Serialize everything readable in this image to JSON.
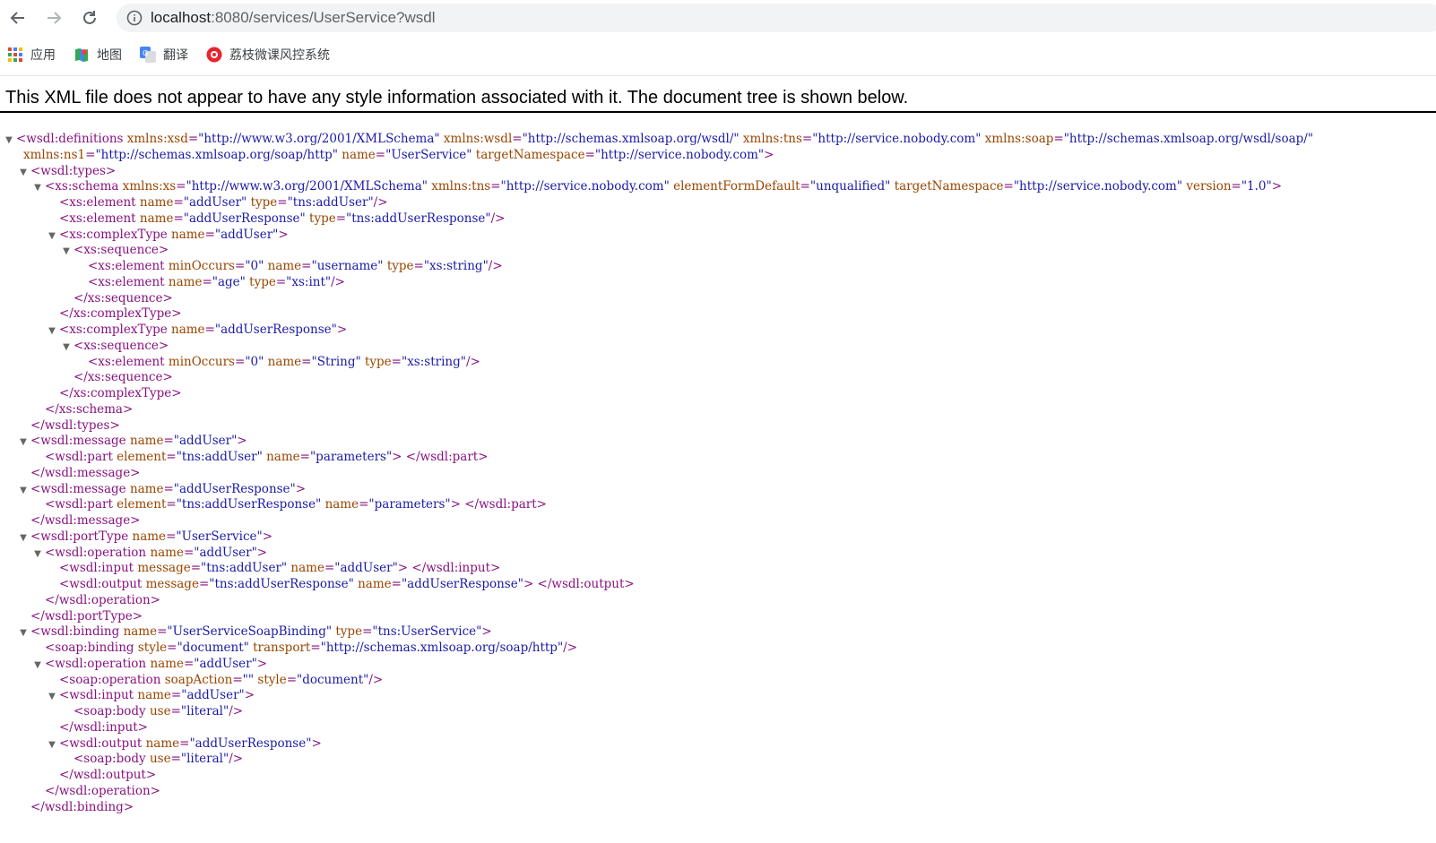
{
  "browser": {
    "url_host": "localhost",
    "url_rest": ":8080/services/UserService?wsdl",
    "bookmarks": [
      {
        "label": "应用",
        "icon": "apps-grid-icon"
      },
      {
        "label": "地图",
        "icon": "maps-icon"
      },
      {
        "label": "翻译",
        "icon": "translate-icon"
      },
      {
        "label": "荔枝微课风控系统",
        "icon": "lizhi-icon"
      }
    ]
  },
  "xml_notice": "This XML file does not appear to have any style information associated with it. The document tree is shown below.",
  "colors": {
    "tag": "#881280",
    "attr": "#994500",
    "value": "#1a1aa6"
  },
  "xml_lines": [
    {
      "d": 0,
      "t": true,
      "p": [
        [
          "tag",
          "<wsdl:definitions"
        ],
        [
          "sp",
          " "
        ],
        [
          "attr",
          "xmlns:xsd"
        ],
        [
          "tag",
          "="
        ],
        [
          "val",
          "\"http://www.w3.org/2001/XMLSchema\""
        ],
        [
          "sp",
          " "
        ],
        [
          "attr",
          "xmlns:wsdl"
        ],
        [
          "tag",
          "="
        ],
        [
          "val",
          "\"http://schemas.xmlsoap.org/wsdl/\""
        ],
        [
          "sp",
          " "
        ],
        [
          "attr",
          "xmlns:tns"
        ],
        [
          "tag",
          "="
        ],
        [
          "val",
          "\"http://service.nobody.com\""
        ],
        [
          "sp",
          " "
        ],
        [
          "attr",
          "xmlns:soap"
        ],
        [
          "tag",
          "="
        ],
        [
          "val",
          "\"http://schemas.xmlsoap.org/wsdl/soap/\""
        ]
      ]
    },
    {
      "d": 0.5,
      "t": false,
      "p": [
        [
          "attr",
          "xmlns:ns1"
        ],
        [
          "tag",
          "="
        ],
        [
          "val",
          "\"http://schemas.xmlsoap.org/soap/http\""
        ],
        [
          "sp",
          " "
        ],
        [
          "attr",
          "name"
        ],
        [
          "tag",
          "="
        ],
        [
          "val",
          "\"UserService\""
        ],
        [
          "sp",
          " "
        ],
        [
          "attr",
          "targetNamespace"
        ],
        [
          "tag",
          "="
        ],
        [
          "val",
          "\"http://service.nobody.com\""
        ],
        [
          "tag",
          ">"
        ]
      ]
    },
    {
      "d": 1,
      "t": true,
      "p": [
        [
          "tag",
          "<wsdl:types>"
        ]
      ]
    },
    {
      "d": 2,
      "t": true,
      "p": [
        [
          "tag",
          "<xs:schema"
        ],
        [
          "sp",
          " "
        ],
        [
          "attr",
          "xmlns:xs"
        ],
        [
          "tag",
          "="
        ],
        [
          "val",
          "\"http://www.w3.org/2001/XMLSchema\""
        ],
        [
          "sp",
          " "
        ],
        [
          "attr",
          "xmlns:tns"
        ],
        [
          "tag",
          "="
        ],
        [
          "val",
          "\"http://service.nobody.com\""
        ],
        [
          "sp",
          " "
        ],
        [
          "attr",
          "elementFormDefault"
        ],
        [
          "tag",
          "="
        ],
        [
          "val",
          "\"unqualified\""
        ],
        [
          "sp",
          " "
        ],
        [
          "attr",
          "targetNamespace"
        ],
        [
          "tag",
          "="
        ],
        [
          "val",
          "\"http://service.nobody.com\""
        ],
        [
          "sp",
          " "
        ],
        [
          "attr",
          "version"
        ],
        [
          "tag",
          "="
        ],
        [
          "val",
          "\"1.0\""
        ],
        [
          "tag",
          ">"
        ]
      ]
    },
    {
      "d": 3,
      "t": false,
      "p": [
        [
          "tag",
          "<xs:element"
        ],
        [
          "sp",
          " "
        ],
        [
          "attr",
          "name"
        ],
        [
          "tag",
          "="
        ],
        [
          "val",
          "\"addUser\""
        ],
        [
          "sp",
          " "
        ],
        [
          "attr",
          "type"
        ],
        [
          "tag",
          "="
        ],
        [
          "val",
          "\"tns:addUser\""
        ],
        [
          "tag",
          "/>"
        ]
      ]
    },
    {
      "d": 3,
      "t": false,
      "p": [
        [
          "tag",
          "<xs:element"
        ],
        [
          "sp",
          " "
        ],
        [
          "attr",
          "name"
        ],
        [
          "tag",
          "="
        ],
        [
          "val",
          "\"addUserResponse\""
        ],
        [
          "sp",
          " "
        ],
        [
          "attr",
          "type"
        ],
        [
          "tag",
          "="
        ],
        [
          "val",
          "\"tns:addUserResponse\""
        ],
        [
          "tag",
          "/>"
        ]
      ]
    },
    {
      "d": 3,
      "t": true,
      "p": [
        [
          "tag",
          "<xs:complexType"
        ],
        [
          "sp",
          " "
        ],
        [
          "attr",
          "name"
        ],
        [
          "tag",
          "="
        ],
        [
          "val",
          "\"addUser\""
        ],
        [
          "tag",
          ">"
        ]
      ]
    },
    {
      "d": 4,
      "t": true,
      "p": [
        [
          "tag",
          "<xs:sequence>"
        ]
      ]
    },
    {
      "d": 5,
      "t": false,
      "p": [
        [
          "tag",
          "<xs:element"
        ],
        [
          "sp",
          " "
        ],
        [
          "attr",
          "minOccurs"
        ],
        [
          "tag",
          "="
        ],
        [
          "val",
          "\"0\""
        ],
        [
          "sp",
          " "
        ],
        [
          "attr",
          "name"
        ],
        [
          "tag",
          "="
        ],
        [
          "val",
          "\"username\""
        ],
        [
          "sp",
          " "
        ],
        [
          "attr",
          "type"
        ],
        [
          "tag",
          "="
        ],
        [
          "val",
          "\"xs:string\""
        ],
        [
          "tag",
          "/>"
        ]
      ]
    },
    {
      "d": 5,
      "t": false,
      "p": [
        [
          "tag",
          "<xs:element"
        ],
        [
          "sp",
          " "
        ],
        [
          "attr",
          "name"
        ],
        [
          "tag",
          "="
        ],
        [
          "val",
          "\"age\""
        ],
        [
          "sp",
          " "
        ],
        [
          "attr",
          "type"
        ],
        [
          "tag",
          "="
        ],
        [
          "val",
          "\"xs:int\""
        ],
        [
          "tag",
          "/>"
        ]
      ]
    },
    {
      "d": 4,
      "t": false,
      "p": [
        [
          "tag",
          "</xs:sequence>"
        ]
      ]
    },
    {
      "d": 3,
      "t": false,
      "p": [
        [
          "tag",
          "</xs:complexType>"
        ]
      ]
    },
    {
      "d": 3,
      "t": true,
      "p": [
        [
          "tag",
          "<xs:complexType"
        ],
        [
          "sp",
          " "
        ],
        [
          "attr",
          "name"
        ],
        [
          "tag",
          "="
        ],
        [
          "val",
          "\"addUserResponse\""
        ],
        [
          "tag",
          ">"
        ]
      ]
    },
    {
      "d": 4,
      "t": true,
      "p": [
        [
          "tag",
          "<xs:sequence>"
        ]
      ]
    },
    {
      "d": 5,
      "t": false,
      "p": [
        [
          "tag",
          "<xs:element"
        ],
        [
          "sp",
          " "
        ],
        [
          "attr",
          "minOccurs"
        ],
        [
          "tag",
          "="
        ],
        [
          "val",
          "\"0\""
        ],
        [
          "sp",
          " "
        ],
        [
          "attr",
          "name"
        ],
        [
          "tag",
          "="
        ],
        [
          "val",
          "\"String\""
        ],
        [
          "sp",
          " "
        ],
        [
          "attr",
          "type"
        ],
        [
          "tag",
          "="
        ],
        [
          "val",
          "\"xs:string\""
        ],
        [
          "tag",
          "/>"
        ]
      ]
    },
    {
      "d": 4,
      "t": false,
      "p": [
        [
          "tag",
          "</xs:sequence>"
        ]
      ]
    },
    {
      "d": 3,
      "t": false,
      "p": [
        [
          "tag",
          "</xs:complexType>"
        ]
      ]
    },
    {
      "d": 2,
      "t": false,
      "p": [
        [
          "tag",
          "</xs:schema>"
        ]
      ]
    },
    {
      "d": 1,
      "t": false,
      "p": [
        [
          "tag",
          "</wsdl:types>"
        ]
      ]
    },
    {
      "d": 1,
      "t": true,
      "p": [
        [
          "tag",
          "<wsdl:message"
        ],
        [
          "sp",
          " "
        ],
        [
          "attr",
          "name"
        ],
        [
          "tag",
          "="
        ],
        [
          "val",
          "\"addUser\""
        ],
        [
          "tag",
          ">"
        ]
      ]
    },
    {
      "d": 2,
      "t": false,
      "p": [
        [
          "tag",
          "<wsdl:part"
        ],
        [
          "sp",
          " "
        ],
        [
          "attr",
          "element"
        ],
        [
          "tag",
          "="
        ],
        [
          "val",
          "\"tns:addUser\""
        ],
        [
          "sp",
          " "
        ],
        [
          "attr",
          "name"
        ],
        [
          "tag",
          "="
        ],
        [
          "val",
          "\"parameters\""
        ],
        [
          "tag",
          ">"
        ],
        [
          "sp",
          " "
        ],
        [
          "tag",
          "</wsdl:part>"
        ]
      ]
    },
    {
      "d": 1,
      "t": false,
      "p": [
        [
          "tag",
          "</wsdl:message>"
        ]
      ]
    },
    {
      "d": 1,
      "t": true,
      "p": [
        [
          "tag",
          "<wsdl:message"
        ],
        [
          "sp",
          " "
        ],
        [
          "attr",
          "name"
        ],
        [
          "tag",
          "="
        ],
        [
          "val",
          "\"addUserResponse\""
        ],
        [
          "tag",
          ">"
        ]
      ]
    },
    {
      "d": 2,
      "t": false,
      "p": [
        [
          "tag",
          "<wsdl:part"
        ],
        [
          "sp",
          " "
        ],
        [
          "attr",
          "element"
        ],
        [
          "tag",
          "="
        ],
        [
          "val",
          "\"tns:addUserResponse\""
        ],
        [
          "sp",
          " "
        ],
        [
          "attr",
          "name"
        ],
        [
          "tag",
          "="
        ],
        [
          "val",
          "\"parameters\""
        ],
        [
          "tag",
          ">"
        ],
        [
          "sp",
          " "
        ],
        [
          "tag",
          "</wsdl:part>"
        ]
      ]
    },
    {
      "d": 1,
      "t": false,
      "p": [
        [
          "tag",
          "</wsdl:message>"
        ]
      ]
    },
    {
      "d": 1,
      "t": true,
      "p": [
        [
          "tag",
          "<wsdl:portType"
        ],
        [
          "sp",
          " "
        ],
        [
          "attr",
          "name"
        ],
        [
          "tag",
          "="
        ],
        [
          "val",
          "\"UserService\""
        ],
        [
          "tag",
          ">"
        ]
      ]
    },
    {
      "d": 2,
      "t": true,
      "p": [
        [
          "tag",
          "<wsdl:operation"
        ],
        [
          "sp",
          " "
        ],
        [
          "attr",
          "name"
        ],
        [
          "tag",
          "="
        ],
        [
          "val",
          "\"addUser\""
        ],
        [
          "tag",
          ">"
        ]
      ]
    },
    {
      "d": 3,
      "t": false,
      "p": [
        [
          "tag",
          "<wsdl:input"
        ],
        [
          "sp",
          " "
        ],
        [
          "attr",
          "message"
        ],
        [
          "tag",
          "="
        ],
        [
          "val",
          "\"tns:addUser\""
        ],
        [
          "sp",
          " "
        ],
        [
          "attr",
          "name"
        ],
        [
          "tag",
          "="
        ],
        [
          "val",
          "\"addUser\""
        ],
        [
          "tag",
          ">"
        ],
        [
          "sp",
          " "
        ],
        [
          "tag",
          "</wsdl:input>"
        ]
      ]
    },
    {
      "d": 3,
      "t": false,
      "p": [
        [
          "tag",
          "<wsdl:output"
        ],
        [
          "sp",
          " "
        ],
        [
          "attr",
          "message"
        ],
        [
          "tag",
          "="
        ],
        [
          "val",
          "\"tns:addUserResponse\""
        ],
        [
          "sp",
          " "
        ],
        [
          "attr",
          "name"
        ],
        [
          "tag",
          "="
        ],
        [
          "val",
          "\"addUserResponse\""
        ],
        [
          "tag",
          ">"
        ],
        [
          "sp",
          " "
        ],
        [
          "tag",
          "</wsdl:output>"
        ]
      ]
    },
    {
      "d": 2,
      "t": false,
      "p": [
        [
          "tag",
          "</wsdl:operation>"
        ]
      ]
    },
    {
      "d": 1,
      "t": false,
      "p": [
        [
          "tag",
          "</wsdl:portType>"
        ]
      ]
    },
    {
      "d": 1,
      "t": true,
      "p": [
        [
          "tag",
          "<wsdl:binding"
        ],
        [
          "sp",
          " "
        ],
        [
          "attr",
          "name"
        ],
        [
          "tag",
          "="
        ],
        [
          "val",
          "\"UserServiceSoapBinding\""
        ],
        [
          "sp",
          " "
        ],
        [
          "attr",
          "type"
        ],
        [
          "tag",
          "="
        ],
        [
          "val",
          "\"tns:UserService\""
        ],
        [
          "tag",
          ">"
        ]
      ]
    },
    {
      "d": 2,
      "t": false,
      "p": [
        [
          "tag",
          "<soap:binding"
        ],
        [
          "sp",
          " "
        ],
        [
          "attr",
          "style"
        ],
        [
          "tag",
          "="
        ],
        [
          "val",
          "\"document\""
        ],
        [
          "sp",
          " "
        ],
        [
          "attr",
          "transport"
        ],
        [
          "tag",
          "="
        ],
        [
          "val",
          "\"http://schemas.xmlsoap.org/soap/http\""
        ],
        [
          "tag",
          "/>"
        ]
      ]
    },
    {
      "d": 2,
      "t": true,
      "p": [
        [
          "tag",
          "<wsdl:operation"
        ],
        [
          "sp",
          " "
        ],
        [
          "attr",
          "name"
        ],
        [
          "tag",
          "="
        ],
        [
          "val",
          "\"addUser\""
        ],
        [
          "tag",
          ">"
        ]
      ]
    },
    {
      "d": 3,
      "t": false,
      "p": [
        [
          "tag",
          "<soap:operation"
        ],
        [
          "sp",
          " "
        ],
        [
          "attr",
          "soapAction"
        ],
        [
          "tag",
          "="
        ],
        [
          "val",
          "\"\""
        ],
        [
          "sp",
          " "
        ],
        [
          "attr",
          "style"
        ],
        [
          "tag",
          "="
        ],
        [
          "val",
          "\"document\""
        ],
        [
          "tag",
          "/>"
        ]
      ]
    },
    {
      "d": 3,
      "t": true,
      "p": [
        [
          "tag",
          "<wsdl:input"
        ],
        [
          "sp",
          " "
        ],
        [
          "attr",
          "name"
        ],
        [
          "tag",
          "="
        ],
        [
          "val",
          "\"addUser\""
        ],
        [
          "tag",
          ">"
        ]
      ]
    },
    {
      "d": 4,
      "t": false,
      "p": [
        [
          "tag",
          "<soap:body"
        ],
        [
          "sp",
          " "
        ],
        [
          "attr",
          "use"
        ],
        [
          "tag",
          "="
        ],
        [
          "val",
          "\"literal\""
        ],
        [
          "tag",
          "/>"
        ]
      ]
    },
    {
      "d": 3,
      "t": false,
      "p": [
        [
          "tag",
          "</wsdl:input>"
        ]
      ]
    },
    {
      "d": 3,
      "t": true,
      "p": [
        [
          "tag",
          "<wsdl:output"
        ],
        [
          "sp",
          " "
        ],
        [
          "attr",
          "name"
        ],
        [
          "tag",
          "="
        ],
        [
          "val",
          "\"addUserResponse\""
        ],
        [
          "tag",
          ">"
        ]
      ]
    },
    {
      "d": 4,
      "t": false,
      "p": [
        [
          "tag",
          "<soap:body"
        ],
        [
          "sp",
          " "
        ],
        [
          "attr",
          "use"
        ],
        [
          "tag",
          "="
        ],
        [
          "val",
          "\"literal\""
        ],
        [
          "tag",
          "/>"
        ]
      ]
    },
    {
      "d": 3,
      "t": false,
      "p": [
        [
          "tag",
          "</wsdl:output>"
        ]
      ]
    },
    {
      "d": 2,
      "t": false,
      "p": [
        [
          "tag",
          "</wsdl:operation>"
        ]
      ]
    },
    {
      "d": 1,
      "t": false,
      "p": [
        [
          "tag",
          "</wsdl:binding>"
        ]
      ]
    }
  ]
}
